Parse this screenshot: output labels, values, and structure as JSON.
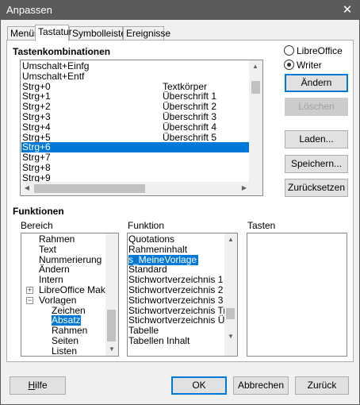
{
  "window": {
    "title": "Anpassen",
    "close_glyph": "✕"
  },
  "tabs": [
    {
      "label": "Menüs"
    },
    {
      "label": "Tastatur"
    },
    {
      "label": "Symbolleisten"
    },
    {
      "label": "Ereignisse"
    }
  ],
  "shortcuts": {
    "heading": "Tastenkombinationen",
    "rows": [
      {
        "key": "Umschalt+Einfg",
        "function": ""
      },
      {
        "key": "Umschalt+Entf",
        "function": ""
      },
      {
        "key": "Strg+0",
        "function": "Textkörper"
      },
      {
        "key": "Strg+1",
        "function": "Überschrift 1"
      },
      {
        "key": "Strg+2",
        "function": "Überschrift 2"
      },
      {
        "key": "Strg+3",
        "function": "Überschrift 3"
      },
      {
        "key": "Strg+4",
        "function": "Überschrift 4"
      },
      {
        "key": "Strg+5",
        "function": "Überschrift 5"
      },
      {
        "key": "Strg+6",
        "function": ""
      },
      {
        "key": "Strg+7",
        "function": ""
      },
      {
        "key": "Strg+8",
        "function": ""
      },
      {
        "key": "Strg+9",
        "function": ""
      }
    ],
    "selected_row": "Strg+6"
  },
  "scope": {
    "libreoffice": "LibreOffice",
    "writer": "Writer",
    "selected": "Writer"
  },
  "buttons": {
    "change": "Ändern",
    "delete": "Löschen",
    "load": "Laden...",
    "save": "Speichern...",
    "reset": "Zurücksetzen"
  },
  "functions": {
    "heading": "Funktionen",
    "area_label": "Bereich",
    "function_label": "Funktion",
    "keys_label": "Tasten"
  },
  "area": {
    "items": [
      {
        "label": "Rahmen",
        "level": 1,
        "expander": ""
      },
      {
        "label": "Text",
        "level": 1,
        "expander": ""
      },
      {
        "label": "Nummerierung",
        "level": 1,
        "expander": ""
      },
      {
        "label": "Ändern",
        "level": 1,
        "expander": ""
      },
      {
        "label": "Intern",
        "level": 1,
        "expander": ""
      },
      {
        "label": "LibreOffice Makros",
        "level": 1,
        "expander": "+"
      },
      {
        "label": "Vorlagen",
        "level": 1,
        "expander": "−"
      },
      {
        "label": "Zeichen",
        "level": 2,
        "expander": ""
      },
      {
        "label": "Absatz",
        "level": 2,
        "expander": ""
      },
      {
        "label": "Rahmen",
        "level": 2,
        "expander": ""
      },
      {
        "label": "Seiten",
        "level": 2,
        "expander": ""
      },
      {
        "label": "Listen",
        "level": 2,
        "expander": ""
      }
    ],
    "selected": "Absatz"
  },
  "function_list": {
    "items": [
      "Quotations",
      "Rahmeninhalt",
      "s_MeineVorlage",
      "Standard",
      "Stichwortverzeichnis 1",
      "Stichwortverzeichnis 2",
      "Stichwortverzeichnis 3",
      "Stichwortverzeichnis Trennz",
      "Stichwortverzeichnis Überschrift",
      "Tabelle",
      "Tabellen Inhalt"
    ],
    "selected": "s_MeineVorlage"
  },
  "footer": {
    "help": "Hilfe",
    "ok": "OK",
    "cancel": "Abbrechen",
    "back": "Zurück"
  }
}
